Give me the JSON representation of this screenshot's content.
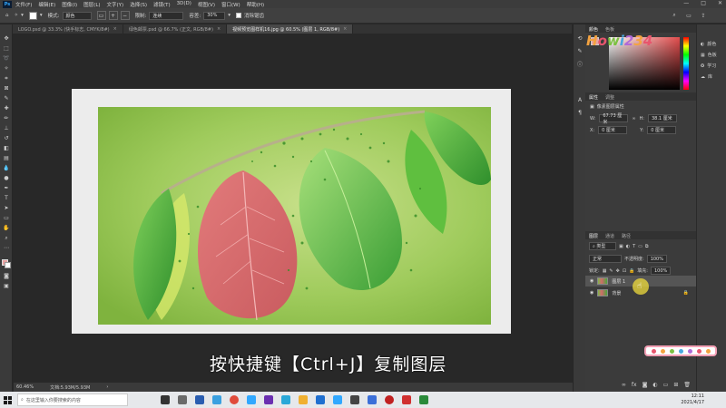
{
  "menubar": {
    "logo": "Ps",
    "items": [
      "文件(F)",
      "编辑(E)",
      "图像(I)",
      "图层(L)",
      "文字(Y)",
      "选择(S)",
      "滤镜(T)",
      "3D(D)",
      "视图(V)",
      "窗口(W)",
      "帮助(H)"
    ],
    "window_controls": [
      "—",
      "□",
      "✕"
    ]
  },
  "options": {
    "mode_label": "模式:",
    "mode_value": "颜色",
    "sample_label": "限制:",
    "sample_value": "连续",
    "tolerance_label": "容差:",
    "tolerance_value": "30%",
    "antialias_label": "消除锯齿"
  },
  "tabs": [
    {
      "label": "LOGO.psd @ 33.3% (快手标志, CMYK/8#)",
      "active": false
    },
    {
      "label": "绿色邮票.psd @ 66.7% (正文, RGB/8#)",
      "active": false
    },
    {
      "label": "视频预览图样机16.jpg @ 60.5% (图层 1, RGB/8#)",
      "active": true
    }
  ],
  "subtitle": "按快捷键【Ctrl+J】复制图层",
  "statusbar": {
    "zoom": "60.46%",
    "doc": "文档:5.93M/5.93M"
  },
  "properties": {
    "tabs": [
      "属性",
      "调整"
    ],
    "header": "像素图层属性",
    "w_label": "W:",
    "w_value": "67.73 厘米",
    "h_label": "H:",
    "h_value": "38.1 厘米",
    "x_label": "X:",
    "x_value": "0 厘米",
    "y_label": "Y:",
    "y_value": "0 厘米"
  },
  "color_panel": {
    "tabs": [
      "颜色",
      "色板"
    ]
  },
  "layers": {
    "tabs": [
      "图层",
      "通道",
      "路径"
    ],
    "filter_label": "类型",
    "blend_mode": "正常",
    "opacity_label": "不透明度:",
    "opacity_value": "100%",
    "lock_label": "锁定:",
    "fill_label": "填充:",
    "fill_value": "100%",
    "items": [
      {
        "name": "图层 1",
        "selected": true
      },
      {
        "name": "背景",
        "selected": false
      }
    ]
  },
  "side_panel": {
    "items": [
      "颜色",
      "色板",
      "学习",
      "库"
    ]
  },
  "taskbar": {
    "search_placeholder": "在这里输入你要搜索的内容",
    "time": "12:11",
    "date": "2021/4/17"
  },
  "watermark": {
    "text": "Howi234",
    "colors": [
      "#f4a340",
      "#e8556d",
      "#7cc142",
      "#4aa8e0",
      "#b06ad8",
      "#f4a340",
      "#e8556d"
    ]
  },
  "colors": {
    "ps_dark": "#282828",
    "panel": "#3b3b3b",
    "leaf_red": "#d86a6a",
    "leaf_green": "#3fa23a",
    "photo_bg": "#9fcb5c"
  }
}
